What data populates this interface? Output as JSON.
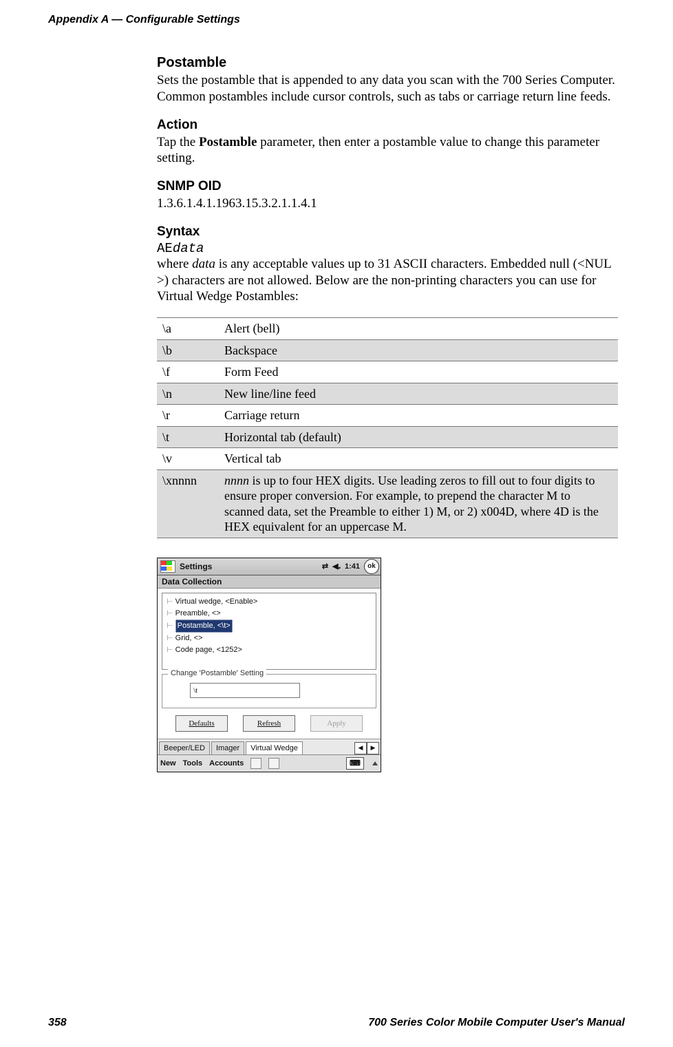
{
  "header": {
    "left": "Appendix A  —  Configurable Settings"
  },
  "section": {
    "postamble": {
      "title": "Postamble",
      "body": "Sets the postamble that is appended to any data you scan with the 700 Series Computer. Common postambles include cursor controls, such as tabs or carriage return line feeds."
    },
    "action": {
      "title": "Action",
      "before": "Tap the ",
      "bold": "Postamble",
      "after": " parameter, then enter a postamble value to change this parameter setting."
    },
    "snmp": {
      "title": "SNMP OID",
      "value": "1.3.6.1.4.1.1963.15.3.2.1.1.4.1"
    },
    "syntax": {
      "title": "Syntax",
      "mono_prefix": "AE",
      "mono_italic": "data",
      "body_before": "where ",
      "body_italic": "data",
      "body_after": " is any acceptable values up to 31 ASCII characters. Embedded null (<NUL >) characters are not allowed. Below are the non-printing characters you can use for Virtual Wedge Postambles:"
    }
  },
  "table": {
    "rows": [
      {
        "code": "\\a",
        "desc": "Alert (bell)",
        "alt": false
      },
      {
        "code": "\\b",
        "desc": "Backspace",
        "alt": true
      },
      {
        "code": "\\f",
        "desc": "Form Feed",
        "alt": false
      },
      {
        "code": "\\n",
        "desc": "New line/line feed",
        "alt": true
      },
      {
        "code": "\\r",
        "desc": "Carriage return",
        "alt": false
      },
      {
        "code": "\\t",
        "desc": "Horizontal tab (default)",
        "alt": true
      },
      {
        "code": "\\v",
        "desc": "Vertical tab",
        "alt": false
      }
    ],
    "xnnnn": {
      "code": "\\xnnnn",
      "italic": "nnnn",
      "rest": " is up to four HEX digits. Use leading zeros to fill out to four digits to ensure proper conversion. For example, to prepend the character M to scanned data, set the Preamble to either 1) M, or 2) x004D, where 4D is the HEX equivalent for an uppercase M."
    }
  },
  "device": {
    "title": "Settings",
    "time": "1:41",
    "ok": "ok",
    "section": "Data Collection",
    "tree": {
      "items": [
        "Virtual wedge, <Enable>",
        "Preamble, <>",
        "Postamble, <\\t>",
        "Grid, <>",
        "Code page, <1252>"
      ],
      "selected_index": 2
    },
    "group": {
      "label": "Change 'Postamble' Setting",
      "value": "\\t"
    },
    "buttons": {
      "defaults": "Defaults",
      "refresh": "Refresh",
      "apply": "Apply"
    },
    "tabs": {
      "items": [
        "Beeper/LED",
        "Imager",
        "Virtual Wedge"
      ],
      "active_index": 2
    },
    "bottombar": {
      "menu1": "New",
      "menu2": "Tools",
      "menu3": "Accounts"
    }
  },
  "footer": {
    "page": "358",
    "title": "700 Series Color Mobile Computer User's Manual"
  }
}
